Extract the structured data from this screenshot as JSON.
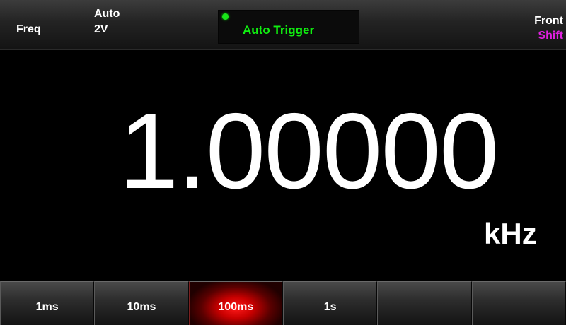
{
  "status": {
    "mode": "Freq",
    "range_mode": "Auto",
    "range_value": "2V",
    "trigger_label": "Auto Trigger",
    "terminal": "Front",
    "shift": "Shift"
  },
  "measurement": {
    "value": "1.00000",
    "unit": "kHz"
  },
  "softkeys": [
    {
      "label": "1ms",
      "active": false
    },
    {
      "label": "10ms",
      "active": false
    },
    {
      "label": "100ms",
      "active": true
    },
    {
      "label": "1s",
      "active": false
    },
    {
      "label": "",
      "active": false
    },
    {
      "label": "",
      "active": false
    }
  ],
  "colors": {
    "trigger_text": "#10ee10",
    "trigger_indicator": "#19e619",
    "shift_text": "#e020e0",
    "active_softkey": "#d00000",
    "background": "#000000"
  },
  "icons": {
    "trigger_indicator": "status-dot-icon"
  }
}
